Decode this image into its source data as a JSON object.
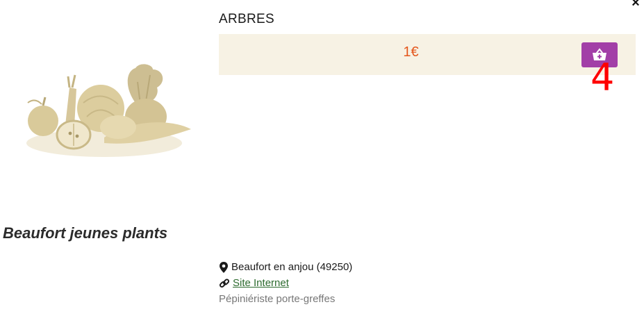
{
  "modal": {
    "close_icon": "close-icon"
  },
  "product": {
    "title": "ARBRES",
    "price": "1€",
    "add_to_basket_icon": "basket-add-icon",
    "annotation": "4"
  },
  "producer": {
    "name": "Beaufort jeunes plants",
    "location": "Beaufort en anjou (49250)",
    "website_label": "Site Internet",
    "category": "Pépiniériste porte-greffes"
  },
  "colors": {
    "price_bar_bg": "#f7f2e4",
    "price_text": "#e4571c",
    "basket_button": "#a23fa7",
    "link": "#2d6b2f",
    "annotation": "#ff0000"
  }
}
